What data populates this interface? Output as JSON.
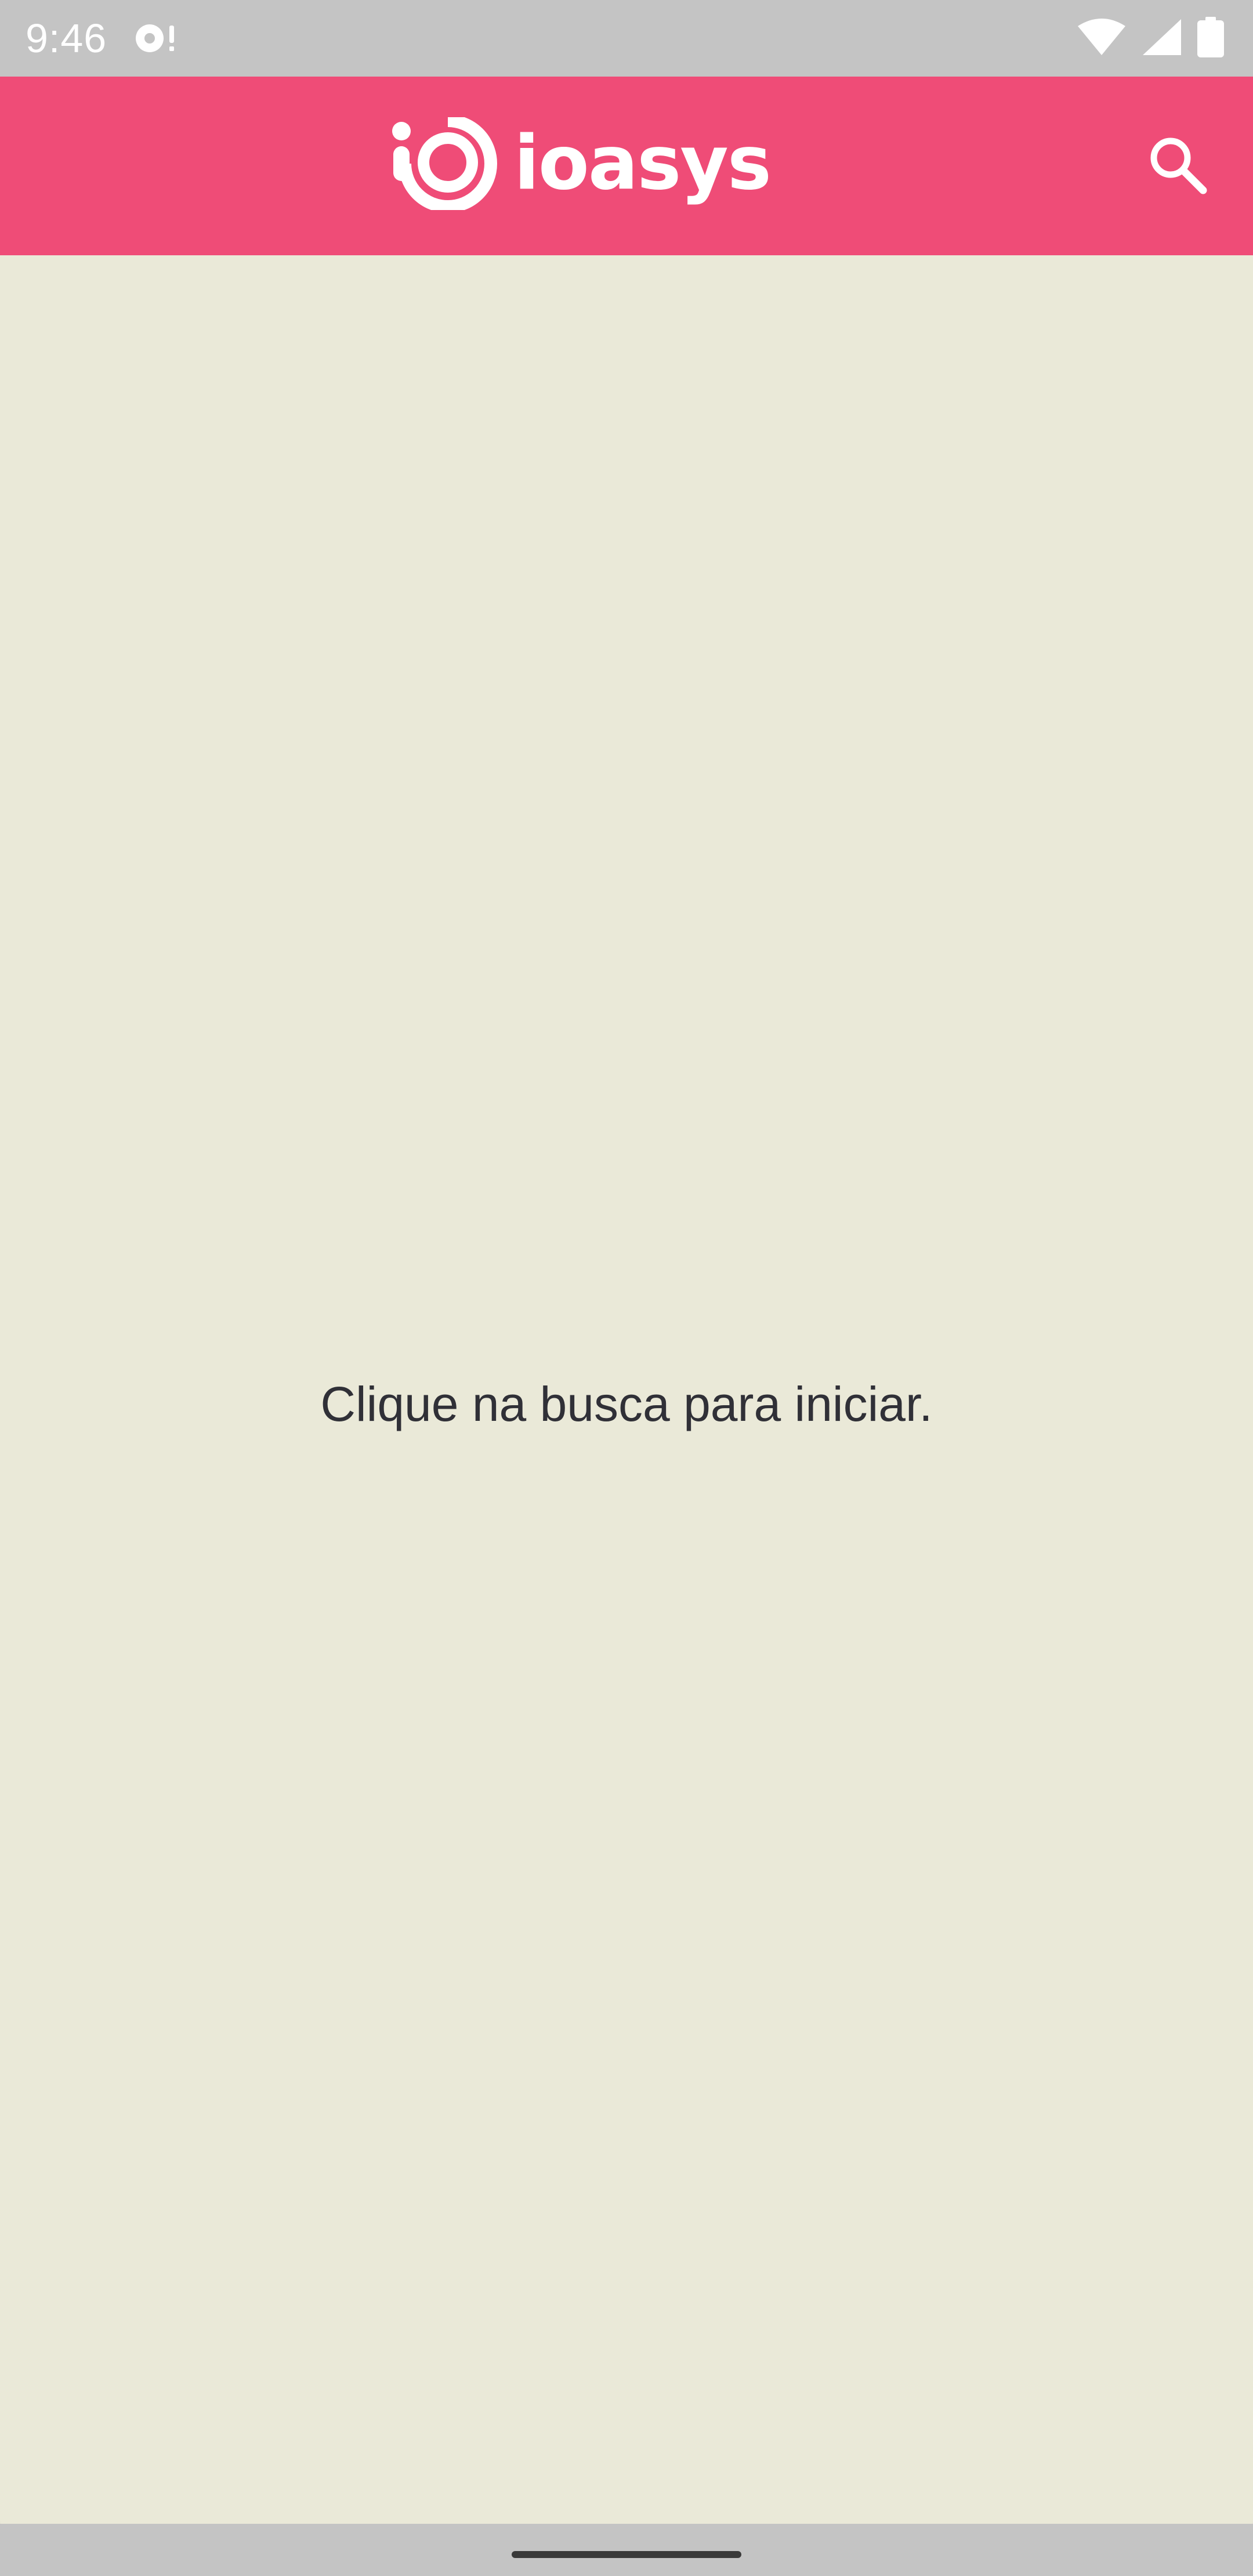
{
  "status_bar": {
    "time": "9:46",
    "left_icon": "sync-alert-icon",
    "right_icons": [
      "wifi-icon",
      "cell-signal-icon",
      "battery-icon"
    ]
  },
  "app_bar": {
    "brand_name": "ioasys",
    "logo_icon": "ioasys-logo-icon",
    "search_icon": "search-icon",
    "color": "#ef4c77"
  },
  "content": {
    "message": "Clique na busca para iniciar.",
    "background": "#eae9d8"
  },
  "nav_bar": {
    "home_indicator": "home-handle"
  }
}
